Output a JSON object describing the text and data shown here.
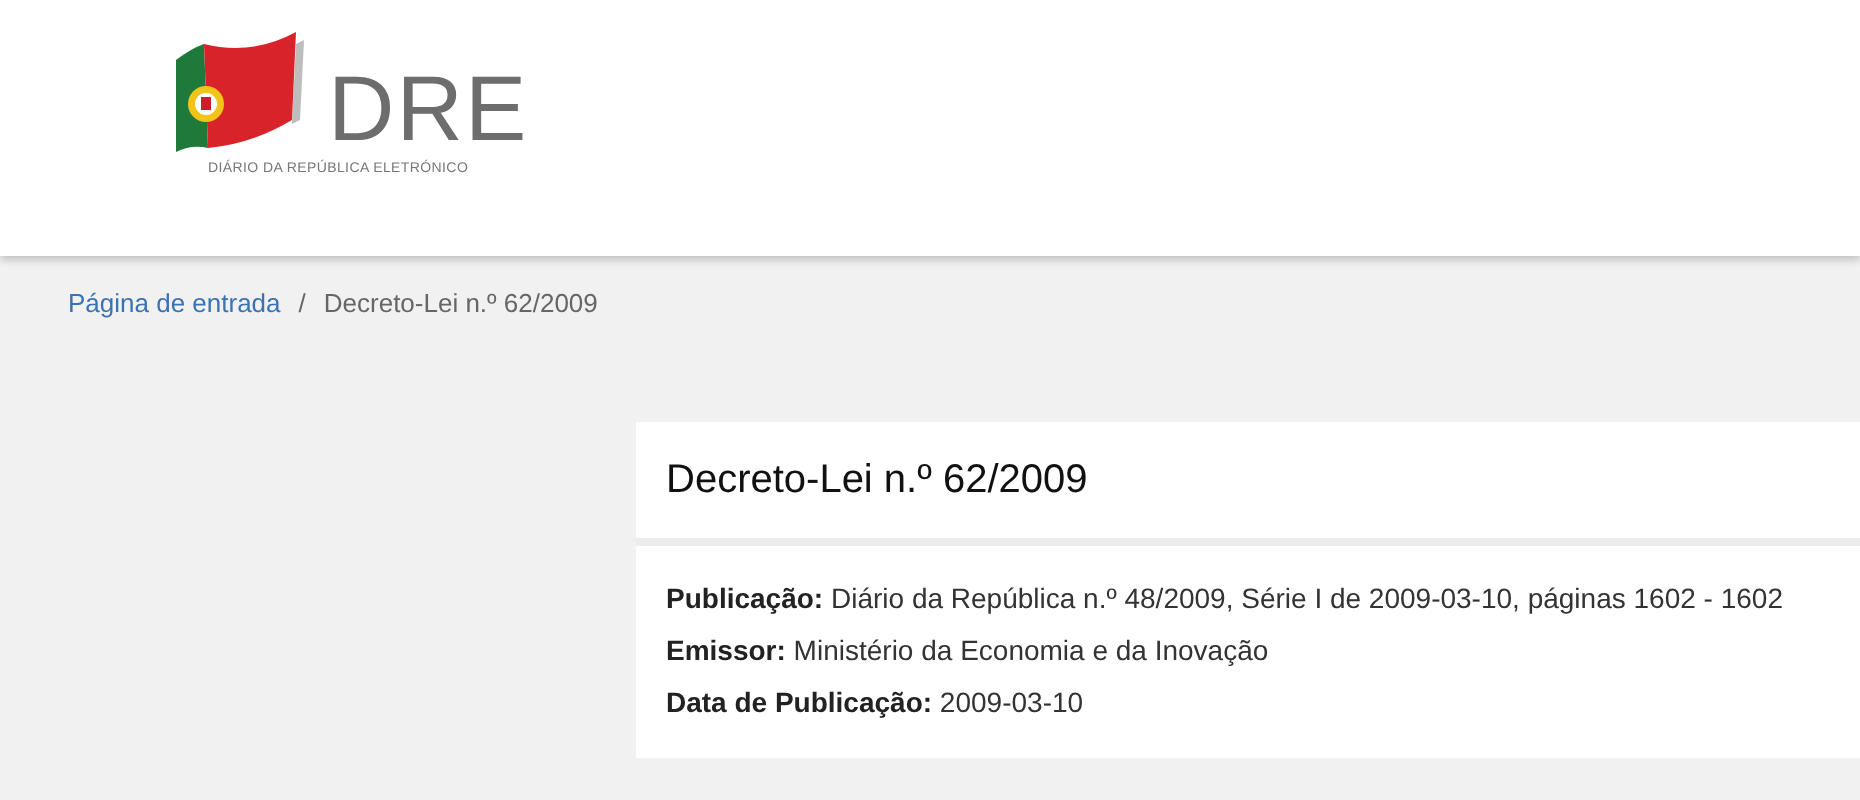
{
  "header": {
    "logo_text": "DRE",
    "logo_subtitle": "DIÁRIO DA REPÚBLICA ELETRÓNICO"
  },
  "breadcrumb": [
    {
      "label": "Página de entrada",
      "kind": "link"
    },
    {
      "label": "/",
      "kind": "separator"
    },
    {
      "label": "Decreto-Lei n.º 62/2009",
      "kind": "current"
    }
  ],
  "document": {
    "title": "Decreto-Lei n.º 62/2009",
    "details": [
      "**Publicação:** Diário da República n.º 48/2009, Série I de 2009-03-10, páginas 1602 - 1602",
      "**Emissor:** Ministério da Economia e da Inovação",
      "**Data de Publicação:** 2009-03-10"
    ]
  }
}
